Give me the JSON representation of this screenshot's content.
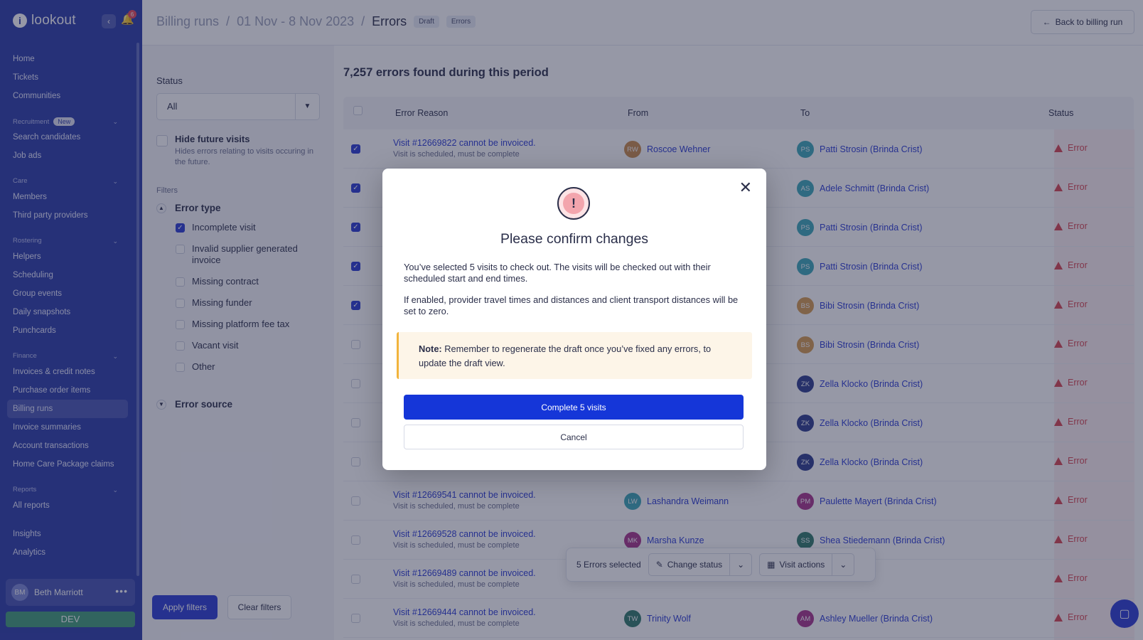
{
  "app": {
    "name": "lookout",
    "notification_count": "6"
  },
  "sidebar": {
    "nav": [
      {
        "type": "item",
        "label": "Home"
      },
      {
        "type": "item",
        "label": "Tickets"
      },
      {
        "type": "item",
        "label": "Communities"
      },
      {
        "type": "section",
        "label": "Recruitment",
        "badge": "New"
      },
      {
        "type": "item",
        "label": "Search candidates"
      },
      {
        "type": "item",
        "label": "Job ads"
      },
      {
        "type": "section",
        "label": "Care"
      },
      {
        "type": "item",
        "label": "Members"
      },
      {
        "type": "item",
        "label": "Third party providers"
      },
      {
        "type": "section",
        "label": "Rostering"
      },
      {
        "type": "item",
        "label": "Helpers"
      },
      {
        "type": "item",
        "label": "Scheduling"
      },
      {
        "type": "item",
        "label": "Group events"
      },
      {
        "type": "item",
        "label": "Daily snapshots"
      },
      {
        "type": "item",
        "label": "Punchcards"
      },
      {
        "type": "section",
        "label": "Finance"
      },
      {
        "type": "item",
        "label": "Invoices & credit notes"
      },
      {
        "type": "item",
        "label": "Purchase order items"
      },
      {
        "type": "item",
        "label": "Billing runs",
        "active": true
      },
      {
        "type": "item",
        "label": "Invoice summaries"
      },
      {
        "type": "item",
        "label": "Account transactions"
      },
      {
        "type": "item",
        "label": "Home Care Package claims"
      },
      {
        "type": "section",
        "label": "Reports"
      },
      {
        "type": "item",
        "label": "All reports"
      },
      {
        "type": "gap"
      },
      {
        "type": "item",
        "label": "Insights"
      },
      {
        "type": "item",
        "label": "Analytics"
      }
    ],
    "user": {
      "initials": "BM",
      "name": "Beth Marriott"
    },
    "env": "DEV"
  },
  "header": {
    "crumb1": "Billing runs",
    "sep": "/",
    "crumb2": "01 Nov - 8 Nov 2023",
    "current": "Errors",
    "tag_draft": "Draft",
    "tag_errors": "Errors",
    "back_label": "Back to billing run"
  },
  "filters": {
    "status_label": "Status",
    "status_value": "All",
    "hide_future_label": "Hide future visits",
    "hide_future_desc": "Hides errors relating to visits occuring in the future.",
    "filters_label": "Filters",
    "error_type_label": "Error type",
    "error_types": [
      {
        "label": "Incomplete visit",
        "checked": true
      },
      {
        "label": "Invalid supplier generated invoice",
        "checked": false
      },
      {
        "label": "Missing contract",
        "checked": false
      },
      {
        "label": "Missing funder",
        "checked": false
      },
      {
        "label": "Missing platform fee tax",
        "checked": false
      },
      {
        "label": "Vacant visit",
        "checked": false
      },
      {
        "label": "Other",
        "checked": false
      }
    ],
    "error_source_label": "Error source",
    "apply_label": "Apply filters",
    "clear_label": "Clear filters"
  },
  "content": {
    "title": "7,257 errors found during this period",
    "columns": {
      "reason": "Error Reason",
      "from": "From",
      "to": "To",
      "status": "Status"
    },
    "rows": [
      {
        "checked": true,
        "reason": "Visit #12669822 cannot be invoiced.",
        "sub": "Visit is scheduled, must be complete",
        "from_i": "RW",
        "from": "Roscoe Wehner",
        "from_c": "#c98a4a",
        "to_i": "PS",
        "to": "Patti Strosin (Brinda Crist)",
        "to_c": "#3aa8b8",
        "status": "Error"
      },
      {
        "checked": true,
        "reason": "",
        "sub": "",
        "from_i": "",
        "from": "",
        "from_c": "",
        "to_i": "AS",
        "to": "Adele Schmitt (Brinda Crist)",
        "to_c": "#3aa8b8",
        "status": "Error"
      },
      {
        "checked": true,
        "reason": "",
        "sub": "",
        "from_i": "",
        "from": "",
        "from_c": "",
        "to_i": "PS",
        "to": "Patti Strosin (Brinda Crist)",
        "to_c": "#3aa8b8",
        "status": "Error"
      },
      {
        "checked": true,
        "reason": "",
        "sub": "",
        "from_i": "",
        "from": "",
        "from_c": "",
        "to_i": "PS",
        "to": "Patti Strosin (Brinda Crist)",
        "to_c": "#3aa8b8",
        "status": "Error"
      },
      {
        "checked": true,
        "reason": "",
        "sub": "",
        "from_i": "",
        "from": "",
        "from_c": "",
        "to_i": "BS",
        "to": "Bibi Strosin (Brinda Crist)",
        "to_c": "#d59a4e",
        "status": "Error"
      },
      {
        "checked": false,
        "reason": "",
        "sub": "",
        "from_i": "",
        "from": "",
        "from_c": "",
        "to_i": "BS",
        "to": "Bibi Strosin (Brinda Crist)",
        "to_c": "#d59a4e",
        "status": "Error"
      },
      {
        "checked": false,
        "reason": "",
        "sub": "",
        "from_i": "",
        "from": "",
        "from_c": "",
        "to_i": "ZK",
        "to": "Zella Klocko (Brinda Crist)",
        "to_c": "#2b3a8c",
        "status": "Error"
      },
      {
        "checked": false,
        "reason": "",
        "sub": "",
        "from_i": "",
        "from": "",
        "from_c": "",
        "to_i": "ZK",
        "to": "Zella Klocko (Brinda Crist)",
        "to_c": "#2b3a8c",
        "status": "Error"
      },
      {
        "checked": false,
        "reason": "",
        "sub": "",
        "from_i": "",
        "from": "",
        "from_c": "",
        "to_i": "ZK",
        "to": "Zella Klocko (Brinda Crist)",
        "to_c": "#2b3a8c",
        "status": "Error"
      },
      {
        "checked": false,
        "reason": "Visit #12669541 cannot be invoiced.",
        "sub": "Visit is scheduled, must be complete",
        "from_i": "LW",
        "from": "Lashandra Weimann",
        "from_c": "#3aa8b8",
        "to_i": "PM",
        "to": "Paulette Mayert (Brinda Crist)",
        "to_c": "#a8328a",
        "status": "Error"
      },
      {
        "checked": false,
        "reason": "Visit #12669528 cannot be invoiced.",
        "sub": "Visit is scheduled, must be complete",
        "from_i": "MK",
        "from": "Marsha Kunze",
        "from_c": "#a8328a",
        "to_i": "SS",
        "to": "Shea Stiedemann (Brinda Crist)",
        "to_c": "#2f7a6a",
        "status": "Error"
      },
      {
        "checked": false,
        "reason": "Visit #12669489 cannot be invoiced.",
        "sub": "Visit is scheduled, must be complete",
        "from_i": "",
        "from": "",
        "from_c": "",
        "to_i": "",
        "to": "inda Crist)",
        "to_c": "",
        "status": "Error"
      },
      {
        "checked": false,
        "reason": "Visit #12669444 cannot be invoiced.",
        "sub": "Visit is scheduled, must be complete",
        "from_i": "TW",
        "from": "Trinity Wolf",
        "from_c": "#2f7a6a",
        "to_i": "AM",
        "to": "Ashley Mueller (Brinda Crist)",
        "to_c": "#a8328a",
        "status": "Error"
      }
    ]
  },
  "selection_bar": {
    "count_label": "5 Errors selected",
    "change_status": "Change status",
    "visit_actions": "Visit actions"
  },
  "modal": {
    "title": "Please confirm changes",
    "p1": "You’ve selected 5 visits to check out. The visits will be checked out with their scheduled start and end times.",
    "p2": "If enabled, provider travel times and distances and client transport distances will be set to zero.",
    "note_bold": "Note:",
    "note_text": " Remember to regenerate the draft once you’ve fixed any errors, to update the draft view.",
    "confirm": "Complete 5 visits",
    "cancel": "Cancel"
  },
  "colors": {
    "primary": "#2a3ad4",
    "sidebar": "#2a3aa8",
    "error": "#d7434f"
  }
}
